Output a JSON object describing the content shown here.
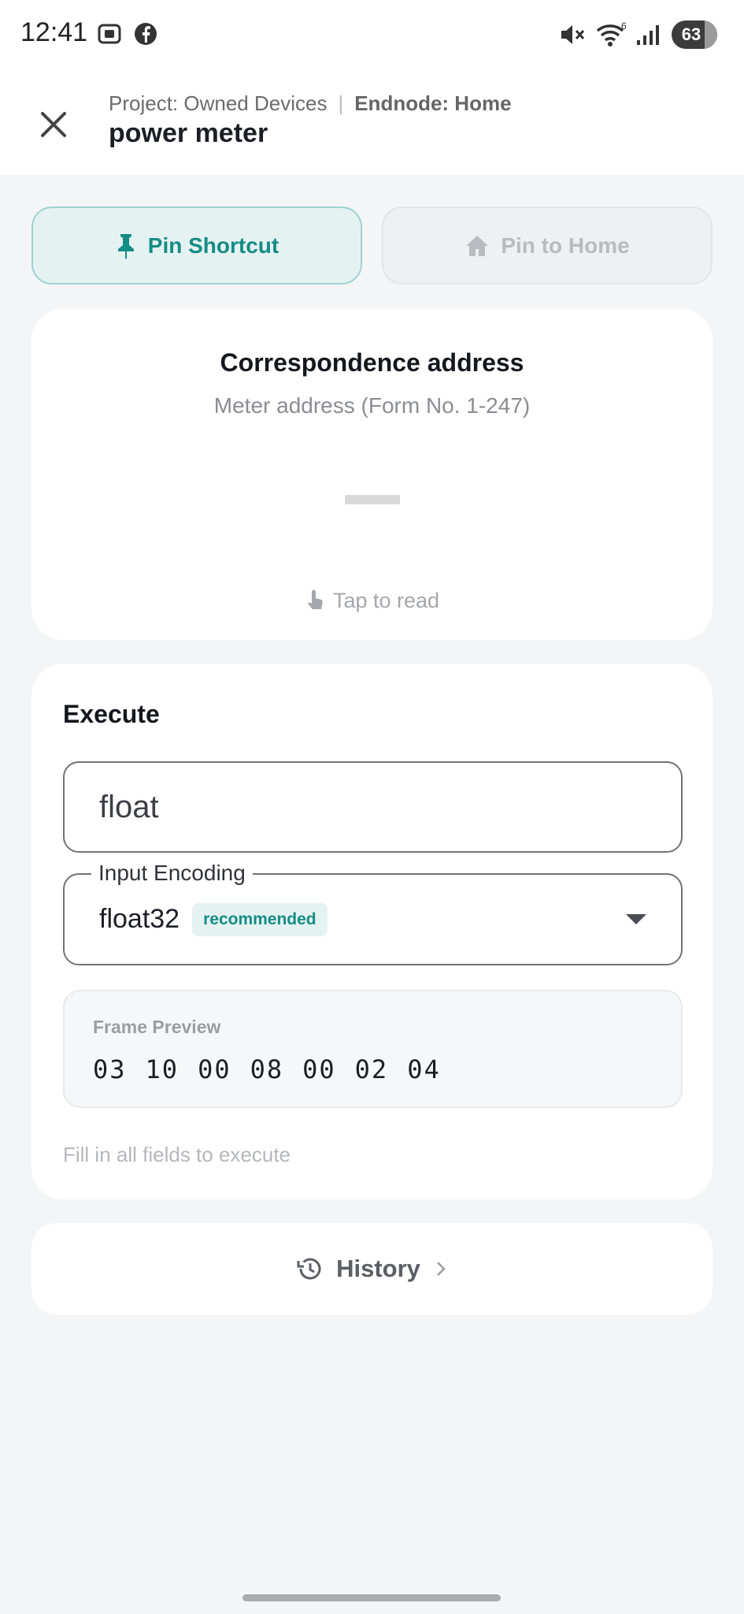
{
  "status_bar": {
    "time": "12:41",
    "battery": "63",
    "wifi_badge": "6"
  },
  "header": {
    "project": "Project: Owned Devices",
    "separator": "|",
    "endnode": "Endnode: Home",
    "title": "power meter"
  },
  "pin": {
    "shortcut_label": "Pin Shortcut",
    "home_label": "Pin to Home"
  },
  "address_card": {
    "title": "Correspondence address",
    "subtitle": "Meter address (Form No. 1-247)",
    "tap_label": "Tap to read"
  },
  "execute": {
    "title": "Execute",
    "input_value": "float",
    "encoding_legend": "Input Encoding",
    "encoding_value": "float32",
    "encoding_badge": "recommended",
    "frame_label": "Frame Preview",
    "frame_bytes": [
      "03",
      "10",
      "00",
      "08",
      "00",
      "02",
      "04"
    ],
    "hint": "Fill in all fields to execute"
  },
  "history": {
    "label": "History"
  },
  "colors": {
    "accent": "#168c86",
    "background": "#f4f5f7"
  }
}
